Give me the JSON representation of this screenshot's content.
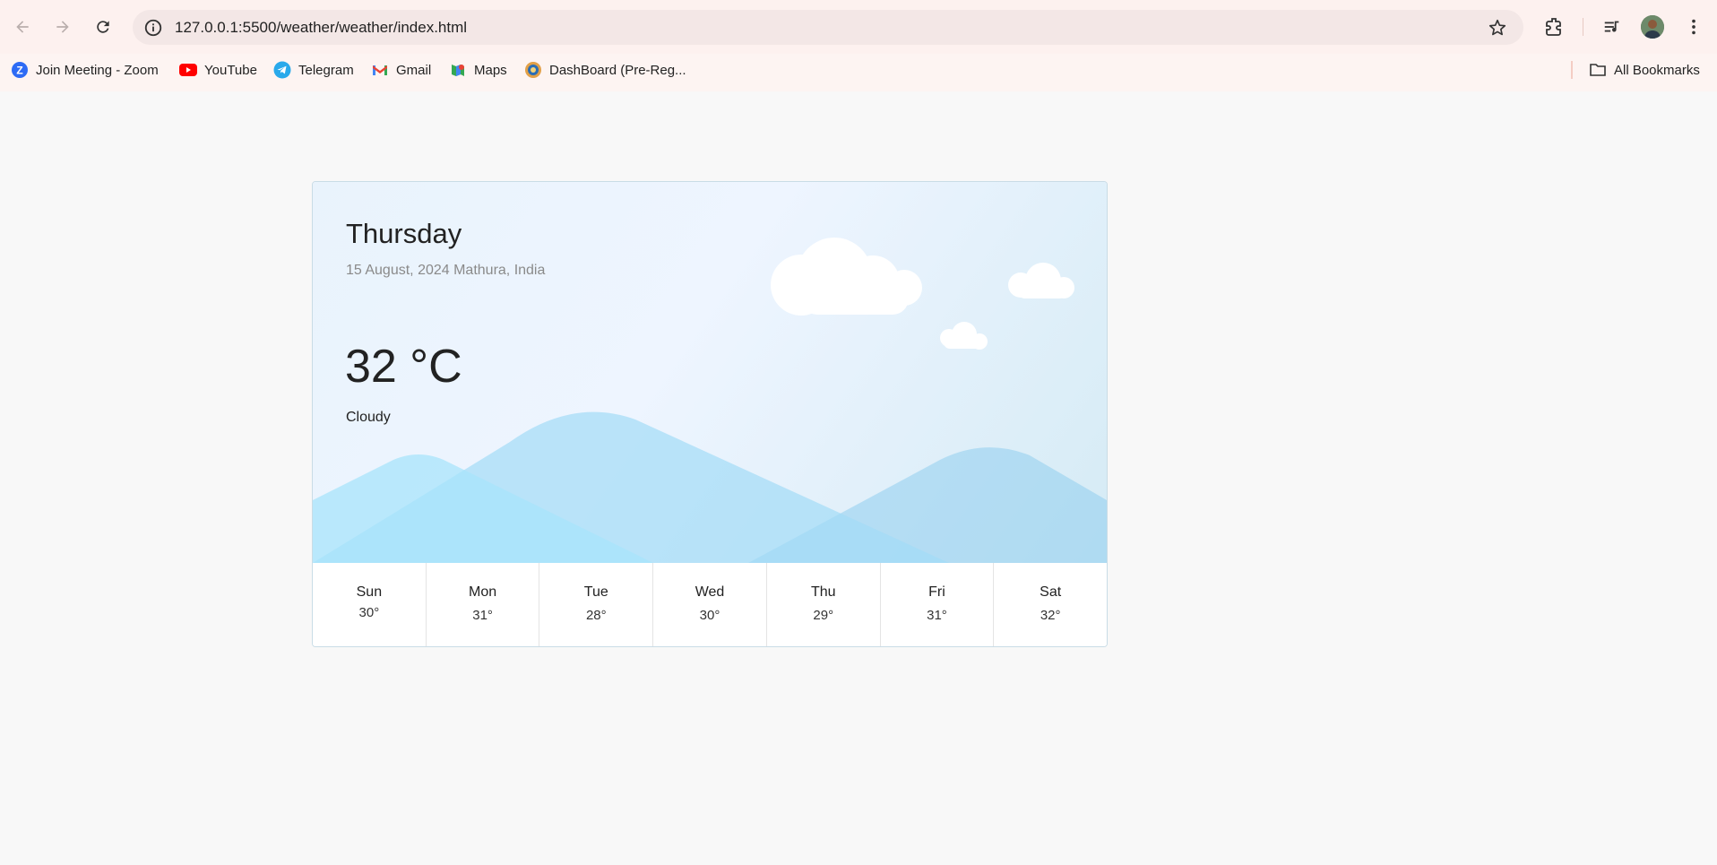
{
  "browser": {
    "url": "127.0.0.1:5500/weather/weather/index.html",
    "bookmarks": [
      {
        "label": "Join Meeting - Zoom",
        "icon": "zoom-icon"
      },
      {
        "label": "YouTube",
        "icon": "youtube-icon"
      },
      {
        "label": "Telegram",
        "icon": "telegram-icon"
      },
      {
        "label": "Gmail",
        "icon": "gmail-icon"
      },
      {
        "label": "Maps",
        "icon": "maps-icon"
      },
      {
        "label": "DashBoard (Pre-Reg...",
        "icon": "dashboard-icon"
      }
    ],
    "all_bookmarks_label": "All Bookmarks"
  },
  "weather": {
    "day": "Thursday",
    "date_location": "15 August, 2024 Mathura, India",
    "temperature": "32 °C",
    "condition": "Cloudy",
    "forecast": [
      {
        "day": "Sun",
        "temp": "30°"
      },
      {
        "day": "Mon",
        "temp": "31°"
      },
      {
        "day": "Tue",
        "temp": "28°"
      },
      {
        "day": "Wed",
        "temp": "30°"
      },
      {
        "day": "Thu",
        "temp": "29°"
      },
      {
        "day": "Fri",
        "temp": "31°"
      },
      {
        "day": "Sat",
        "temp": "32°"
      }
    ]
  },
  "colors": {
    "chrome_bg": "#fdf1ef",
    "mountain_light": "#a8e4fb",
    "mountain_mid": "#9fd9f6",
    "mountain_back": "#8fcdef"
  }
}
